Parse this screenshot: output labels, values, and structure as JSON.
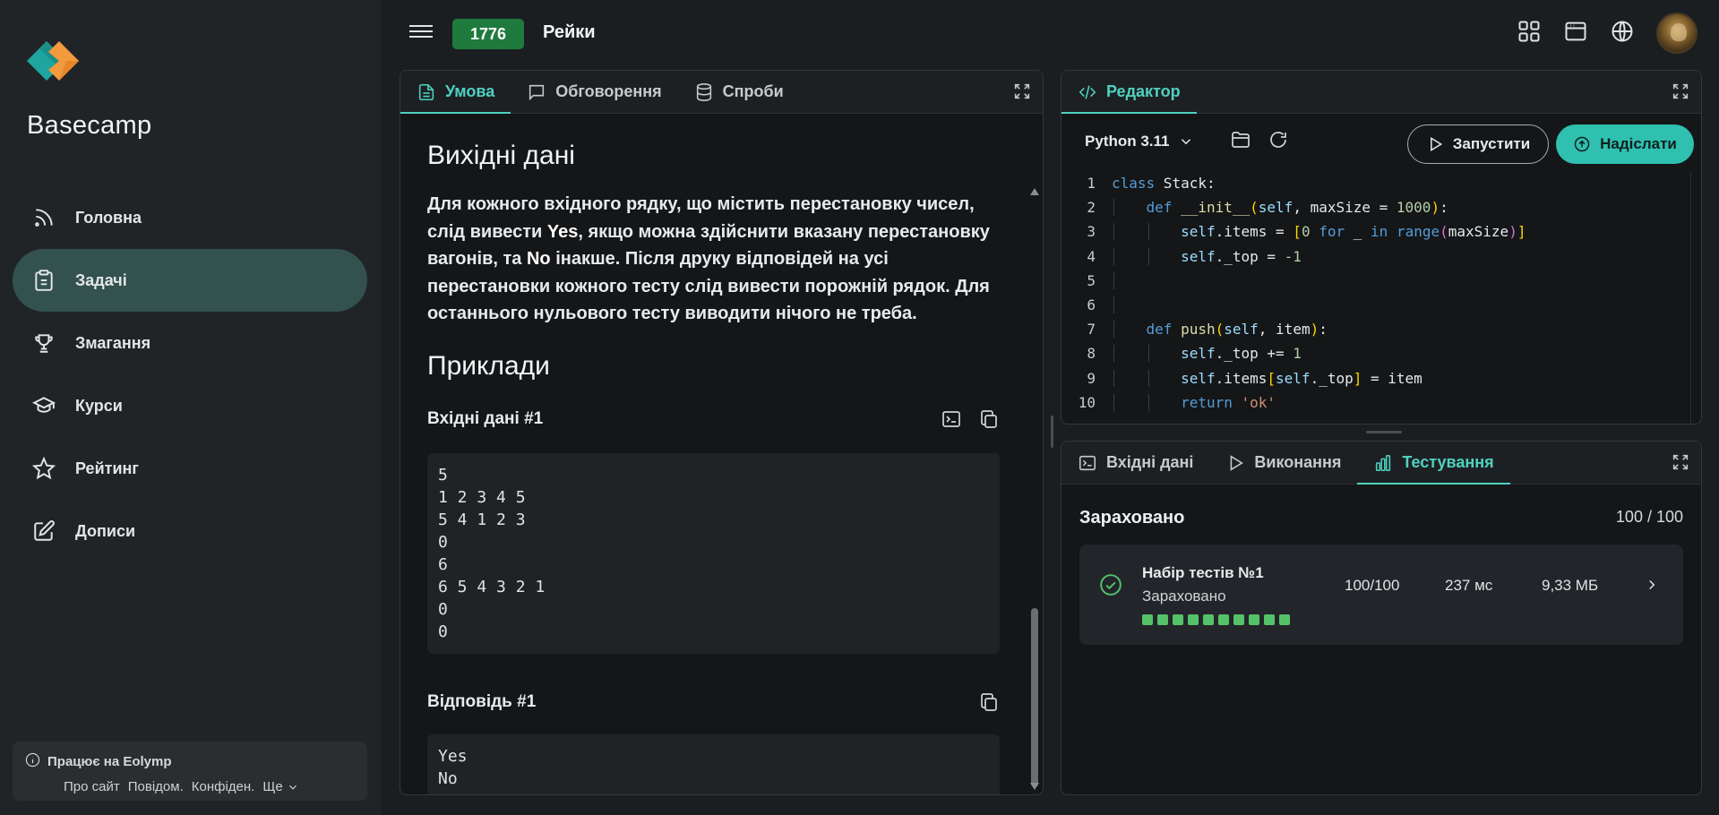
{
  "sidebar": {
    "brand": "Basecamp",
    "items": [
      {
        "label": "Головна",
        "icon": "rss-icon"
      },
      {
        "label": "Задачі",
        "icon": "clipboard-icon",
        "active": true
      },
      {
        "label": "Змагання",
        "icon": "trophy-icon"
      },
      {
        "label": "Курси",
        "icon": "graduation-cap-icon"
      },
      {
        "label": "Рейтинг",
        "icon": "star-icon"
      },
      {
        "label": "Дописи",
        "icon": "edit-icon"
      }
    ],
    "footer": {
      "title": "Працює на Eolymp",
      "links": [
        "Про сайт",
        "Повідом.",
        "Конфіден.",
        "Ще"
      ]
    }
  },
  "header": {
    "problem_id": "1776",
    "problem_title": "Рейки",
    "icons": [
      "grid-icon",
      "window-icon",
      "globe-icon",
      "avatar"
    ]
  },
  "left_panel": {
    "tabs": [
      {
        "label": "Умова",
        "icon": "file-icon",
        "active": true
      },
      {
        "label": "Обговорення",
        "icon": "chat-icon"
      },
      {
        "label": "Спроби",
        "icon": "database-icon"
      }
    ],
    "output_heading": "Вихідні дані",
    "output_text_1": "Для кожного вхідного рядку, що містить перестановку чисел, слід вивести ",
    "output_yes": "Yes",
    "output_text_2": ", якщо можна здійснити вказану перестановку вагонів, та ",
    "output_no": "No",
    "output_text_3": " інакше. Після друку відповідей на усі перестановки кожного тесту слід вивести порожній рядок. Для останнього нульового тесту виводити нічого не треба.",
    "examples_heading": "Приклади",
    "input_label": "Вхідні дані #1",
    "input_sample": "5\n1 2 3 4 5\n5 4 1 2 3\n0\n6\n6 5 4 3 2 1\n0\n0",
    "answer_label": "Відповідь #1",
    "answer_sample": "Yes\nNo"
  },
  "editor_panel": {
    "tab_label": "Редактор",
    "language": "Python 3.11",
    "run_label": "Запустити",
    "submit_label": "Надіслати",
    "line_numbers": [
      "1",
      "2",
      "3",
      "4",
      "5",
      "6",
      "7",
      "8",
      "9",
      "10"
    ],
    "code_lines": [
      "class Stack:",
      "    def __init__(self, maxSize = 1000):",
      "        self.items = [0 for _ in range(maxSize)]",
      "        self._top = -1",
      "",
      "",
      "    def push(self, item):",
      "        self._top += 1",
      "        self.items[self._top] = item",
      "        return 'ok'"
    ]
  },
  "result_panel": {
    "tabs": [
      {
        "label": "Вхідні дані",
        "icon": "terminal-icon"
      },
      {
        "label": "Виконання",
        "icon": "play-icon"
      },
      {
        "label": "Тестування",
        "icon": "bar-chart-icon",
        "active": true
      }
    ],
    "status": "Зараховано",
    "score": "100 / 100",
    "test_set": {
      "title": "Набір тестів №1",
      "status": "Зараховано",
      "score": "100/100",
      "time": "237 мс",
      "memory": "9,33 МБ",
      "passed_count": 10,
      "color": "#55c26a"
    }
  },
  "colors": {
    "accent": "#4fd1c0",
    "submit": "#2fc0b0",
    "id_badge": "#1f7a3d",
    "sidebar_active": "#33514d"
  }
}
